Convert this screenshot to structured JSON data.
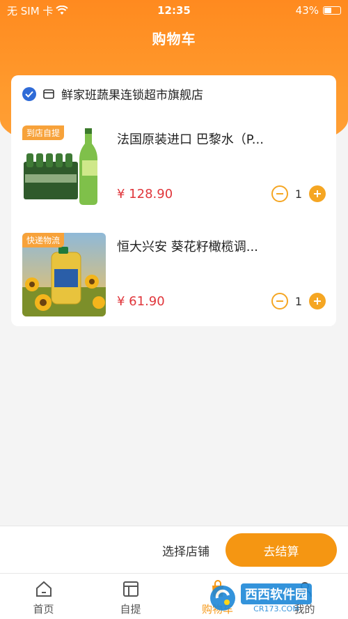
{
  "status_bar": {
    "carrier": "无 SIM 卡",
    "time": "12:35",
    "battery": "43%",
    "battery_level": 0.43
  },
  "header": {
    "title": "购物车"
  },
  "store": {
    "name": "鲜家班蔬果连锁超市旗舰店",
    "checked": true
  },
  "items": [
    {
      "tag": "到店自提",
      "title": "法国原装进口 巴黎水（P...",
      "price": "¥ 128.90",
      "qty": "1"
    },
    {
      "tag": "快递物流",
      "title": "恒大兴安 葵花籽橄榄调...",
      "price": "¥ 61.90",
      "qty": "1"
    }
  ],
  "footer": {
    "select_store": "选择店铺",
    "checkout": "去结算"
  },
  "tabbar": [
    {
      "label": "首页",
      "icon": "home-icon"
    },
    {
      "label": "自提",
      "icon": "layout-icon"
    },
    {
      "label": "购物车",
      "icon": "cart-bag-icon",
      "active": true
    },
    {
      "label": "我的",
      "icon": "user-icon"
    }
  ],
  "watermark": {
    "text": "西西软件园",
    "sub": "CR173.COM"
  },
  "colors": {
    "accent": "#f59612",
    "price": "#e0363b",
    "check": "#2f6bd7"
  }
}
